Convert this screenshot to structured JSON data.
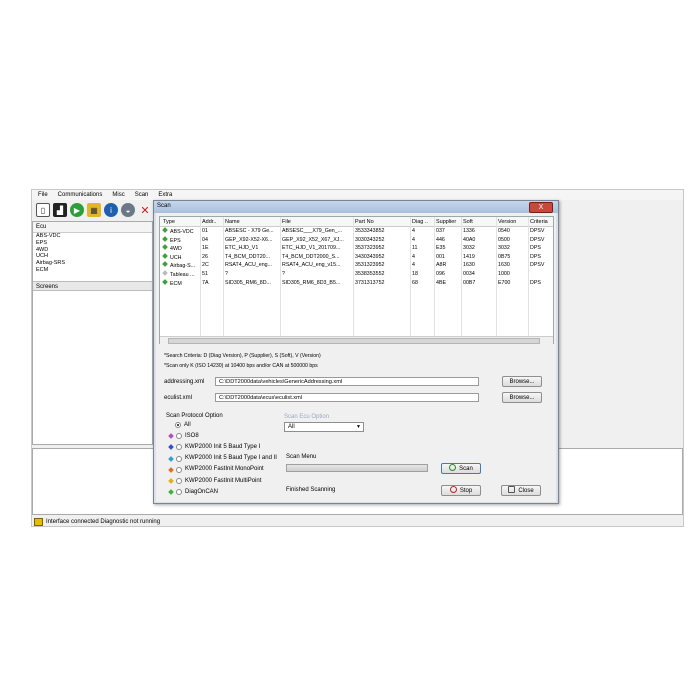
{
  "menu": [
    "File",
    "Communications",
    "Misc",
    "Scan",
    "Extra"
  ],
  "toolbar_icons": [
    "document-icon",
    "chart-icon",
    "play-icon",
    "chip-icon",
    "info-icon",
    "dashboard-icon",
    "close-icon"
  ],
  "left_panel": {
    "header": "Ecu",
    "items": [
      "ABS-VDC",
      "EPS",
      "4WD",
      "UCH",
      "Airbag-SRS",
      "ECM"
    ],
    "screens_label": "Screens"
  },
  "status": {
    "text": "Interface connected Diagnostic not running"
  },
  "dialog": {
    "title": "Scan",
    "close_label": "X",
    "columns": [
      "Type",
      "Addr..",
      "Name",
      "File",
      "Part No",
      "Diag ..",
      "Supplier",
      "Soft",
      "Version",
      "Criteria"
    ],
    "rows": [
      {
        "type": "ABS-VDC",
        "addr": "01",
        "name": "ABSESC - X79 Ge...",
        "file": "ABSESC___X79_Gen_...",
        "part": "3533343852",
        "diag": "4",
        "supplier": "037",
        "soft": "1336",
        "version": "0540",
        "criteria": "DPSV"
      },
      {
        "type": "EPS",
        "addr": "04",
        "name": "GEP_X92-X52-X6...",
        "file": "GEP_X92_X52_X67_XJ...",
        "part": "3030343252",
        "diag": "4",
        "supplier": "446",
        "soft": "40A0",
        "version": "0500",
        "criteria": "DPSV"
      },
      {
        "type": "4WD",
        "addr": "1E",
        "name": "ETC_HJD_V1",
        "file": "ETC_HJD_V1_201709...",
        "part": "3537323952",
        "diag": "11",
        "supplier": "E35",
        "soft": "3032",
        "version": "3032",
        "criteria": "DPS"
      },
      {
        "type": "UCH",
        "addr": "26",
        "name": "T4_BCM_DDT20...",
        "file": "T4_BCM_DDT2000_S...",
        "part": "3430343952",
        "diag": "4",
        "supplier": "001",
        "soft": "1419",
        "version": "0B75",
        "criteria": "DPS"
      },
      {
        "type": "Airbag-S...",
        "addr": "2C",
        "name": "RSAT4_ACU_eng...",
        "file": "RSAT4_ACU_eng_v15...",
        "part": "3531323952",
        "diag": "4",
        "supplier": "A8R",
        "soft": "1630",
        "version": "1630",
        "criteria": "DPSV"
      },
      {
        "type": "Tableau ...",
        "addr": "51",
        "name": "?",
        "file": "?",
        "part": "3538353552",
        "diag": "18",
        "supplier": "096",
        "soft": "0034",
        "version": "1000",
        "criteria": ""
      },
      {
        "type": "ECM",
        "addr": "7A",
        "name": "SID305_RM6_8D...",
        "file": "SID305_RM6_8D3_B5...",
        "part": "3731313752",
        "diag": "68",
        "supplier": "4BE",
        "soft": "00B7",
        "version": "E700",
        "criteria": "DPS"
      }
    ],
    "row_colors": [
      "#3aa23a",
      "#3aa23a",
      "#3aa23a",
      "#3aa23a",
      "#3aa23a",
      "#bbbbbb",
      "#3aa23a"
    ],
    "criteria_note": "*Search Criteria: D (Diag Version), P (Supplier), S (Soft), V (Version)",
    "scan_note": "*Scan only K (ISO 14230) at 10400 bps and/or CAN at 500000 bps",
    "addressing_label": "addressing.xml",
    "addressing_value": "C:\\DDT2000data\\vehicles\\GenericAddressing.xml",
    "eculist_label": "eculist.xml",
    "eculist_value": "C:\\DDT2000data\\ecus\\eculist.xml",
    "browse_label": "Browse...",
    "protocol_title": "Scan Protocol Option",
    "protocols": [
      {
        "label": "All",
        "color": ""
      },
      {
        "label": "ISO8",
        "color": "#b050c0"
      },
      {
        "label": "KWP2000 Init 5 Baud Type I",
        "color": "#3050d0"
      },
      {
        "label": "KWP2000 Init 5 Baud Type I and II",
        "color": "#30a0d0"
      },
      {
        "label": "KWP2000 FastInit MonoPoint",
        "color": "#e07020"
      },
      {
        "label": "KWP2000 FastInit MultiPoint",
        "color": "#e0b020"
      },
      {
        "label": "DiagOnCAN",
        "color": "#40b040"
      }
    ],
    "ecu_option_title": "Scan Ecu Option",
    "ecu_option_value": "All",
    "scan_menu_title": "Scan Menu",
    "scan_label": "Scan",
    "stop_label": "Stop",
    "close_button_label": "Close",
    "progress_text": "Finished Scanning"
  }
}
